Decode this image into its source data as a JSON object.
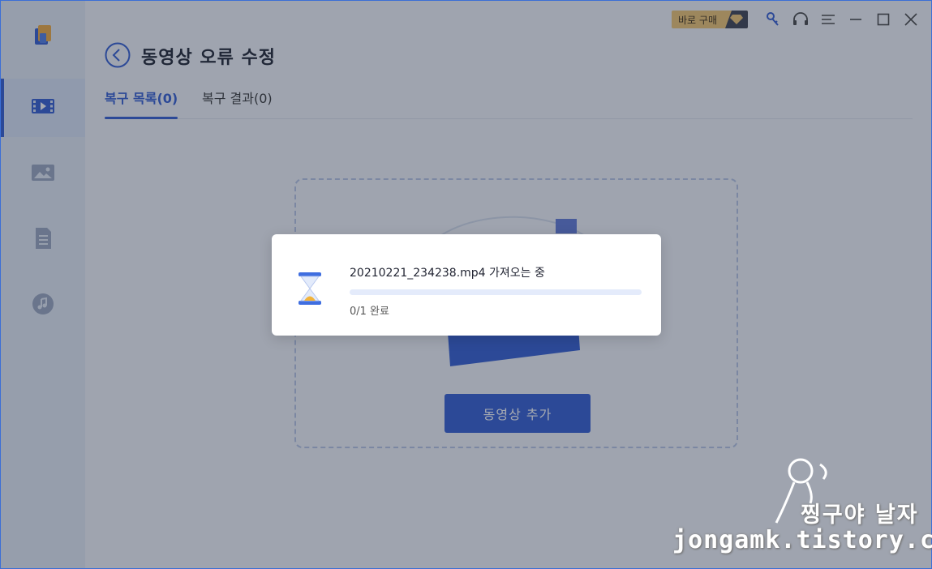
{
  "header": {
    "title": "동영상 오류 수정",
    "buy_label": "바로 구매"
  },
  "sidebar": {
    "items": [
      {
        "icon": "video-repair-icon",
        "active": true
      },
      {
        "icon": "photo-repair-icon",
        "active": false
      },
      {
        "icon": "document-repair-icon",
        "active": false
      },
      {
        "icon": "audio-repair-icon",
        "active": false
      }
    ]
  },
  "tabs": [
    {
      "label": "복구 목록(0)",
      "active": true
    },
    {
      "label": "복구 결과(0)",
      "active": false
    }
  ],
  "dropzone": {
    "add_button": "동영상 추가"
  },
  "modal": {
    "title": "20210221_234238.mp4 가져오는 중",
    "progress": 0,
    "status": "0/1 완료"
  },
  "watermark": {
    "line1": "찡구야 날자",
    "line2": "jongamk.tistory.com"
  },
  "colors": {
    "accent": "#2f5bd3",
    "buy": "#f2c46e"
  }
}
